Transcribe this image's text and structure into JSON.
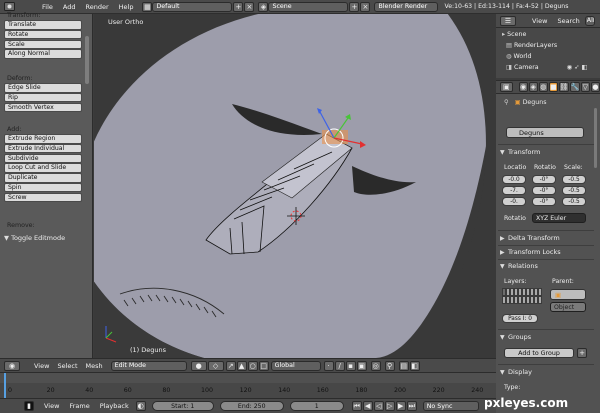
{
  "top": {
    "menus": [
      "File",
      "Add",
      "Render",
      "Help"
    ],
    "layout": "Default",
    "scene": "Scene",
    "engine": "Blender Render",
    "stats": "Ve:10-63 | Ed:13-114 | Fa:4-52 | Deguns"
  },
  "toolshelf": {
    "transform_label": "Transform:",
    "transform": [
      "Translate",
      "Rotate",
      "Scale",
      "Along Normal"
    ],
    "deform_label": "Deform:",
    "deform": [
      "Edge Slide",
      "Rip",
      "Smooth Vertex"
    ],
    "add_label": "Add:",
    "add": [
      "Extrude Region",
      "Extrude Individual",
      "Subdivide",
      "Loop Cut and Slide",
      "Duplicate",
      "Spin",
      "Screw"
    ],
    "remove_label": "Remove:",
    "toggle": "Toggle Editmode"
  },
  "viewport": {
    "view_label": "User Ortho",
    "object_label": "(1) Deguns"
  },
  "vp_header": {
    "menus": [
      "View",
      "Select",
      "Mesh"
    ],
    "mode": "Edit Mode",
    "orientation": "Global"
  },
  "timeline": {
    "ticks": [
      "0",
      "20",
      "40",
      "60",
      "80",
      "100",
      "120",
      "140",
      "160",
      "180",
      "200",
      "220",
      "240"
    ]
  },
  "bottom": {
    "menus": [
      "View",
      "Frame",
      "Playback"
    ],
    "start": "Start: 1",
    "end": "End: 250",
    "current": "1",
    "sync": "No Sync"
  },
  "outliner": {
    "menus": [
      "View",
      "Search"
    ],
    "all_label": "All",
    "items": [
      "Scene",
      "RenderLayers",
      "World",
      "Camera"
    ]
  },
  "properties": {
    "object_name": "Deguns",
    "object_field": "Deguns",
    "transform_title": "Transform",
    "location_label": "Locatio",
    "rotation_label": "Rotatio",
    "scale_label": "Scale:",
    "location": [
      "-0.0",
      "-7.",
      "-0."
    ],
    "rotation": [
      "-0°",
      "-0°",
      "-0°"
    ],
    "scale": [
      "-0.5",
      "-0.5",
      "-0.5"
    ],
    "rotation_mode_label": "Rotatio",
    "rotation_mode": "XYZ Euler",
    "delta_title": "Delta Transform",
    "locks_title": "Transform Locks",
    "relations_title": "Relations",
    "layers_label": "Layers:",
    "parent_label": "Parent:",
    "parent_type": "Object",
    "pass_index": "Pass I: 0",
    "groups_title": "Groups",
    "add_group": "Add to Group",
    "display_title": "Display",
    "type_label": "Type:"
  },
  "watermark": "pxleyes.com",
  "colors": {
    "accent": "#57a0e2",
    "panel": "#525252",
    "header": "#4a4a4a",
    "mesh": "#9d9dab"
  }
}
